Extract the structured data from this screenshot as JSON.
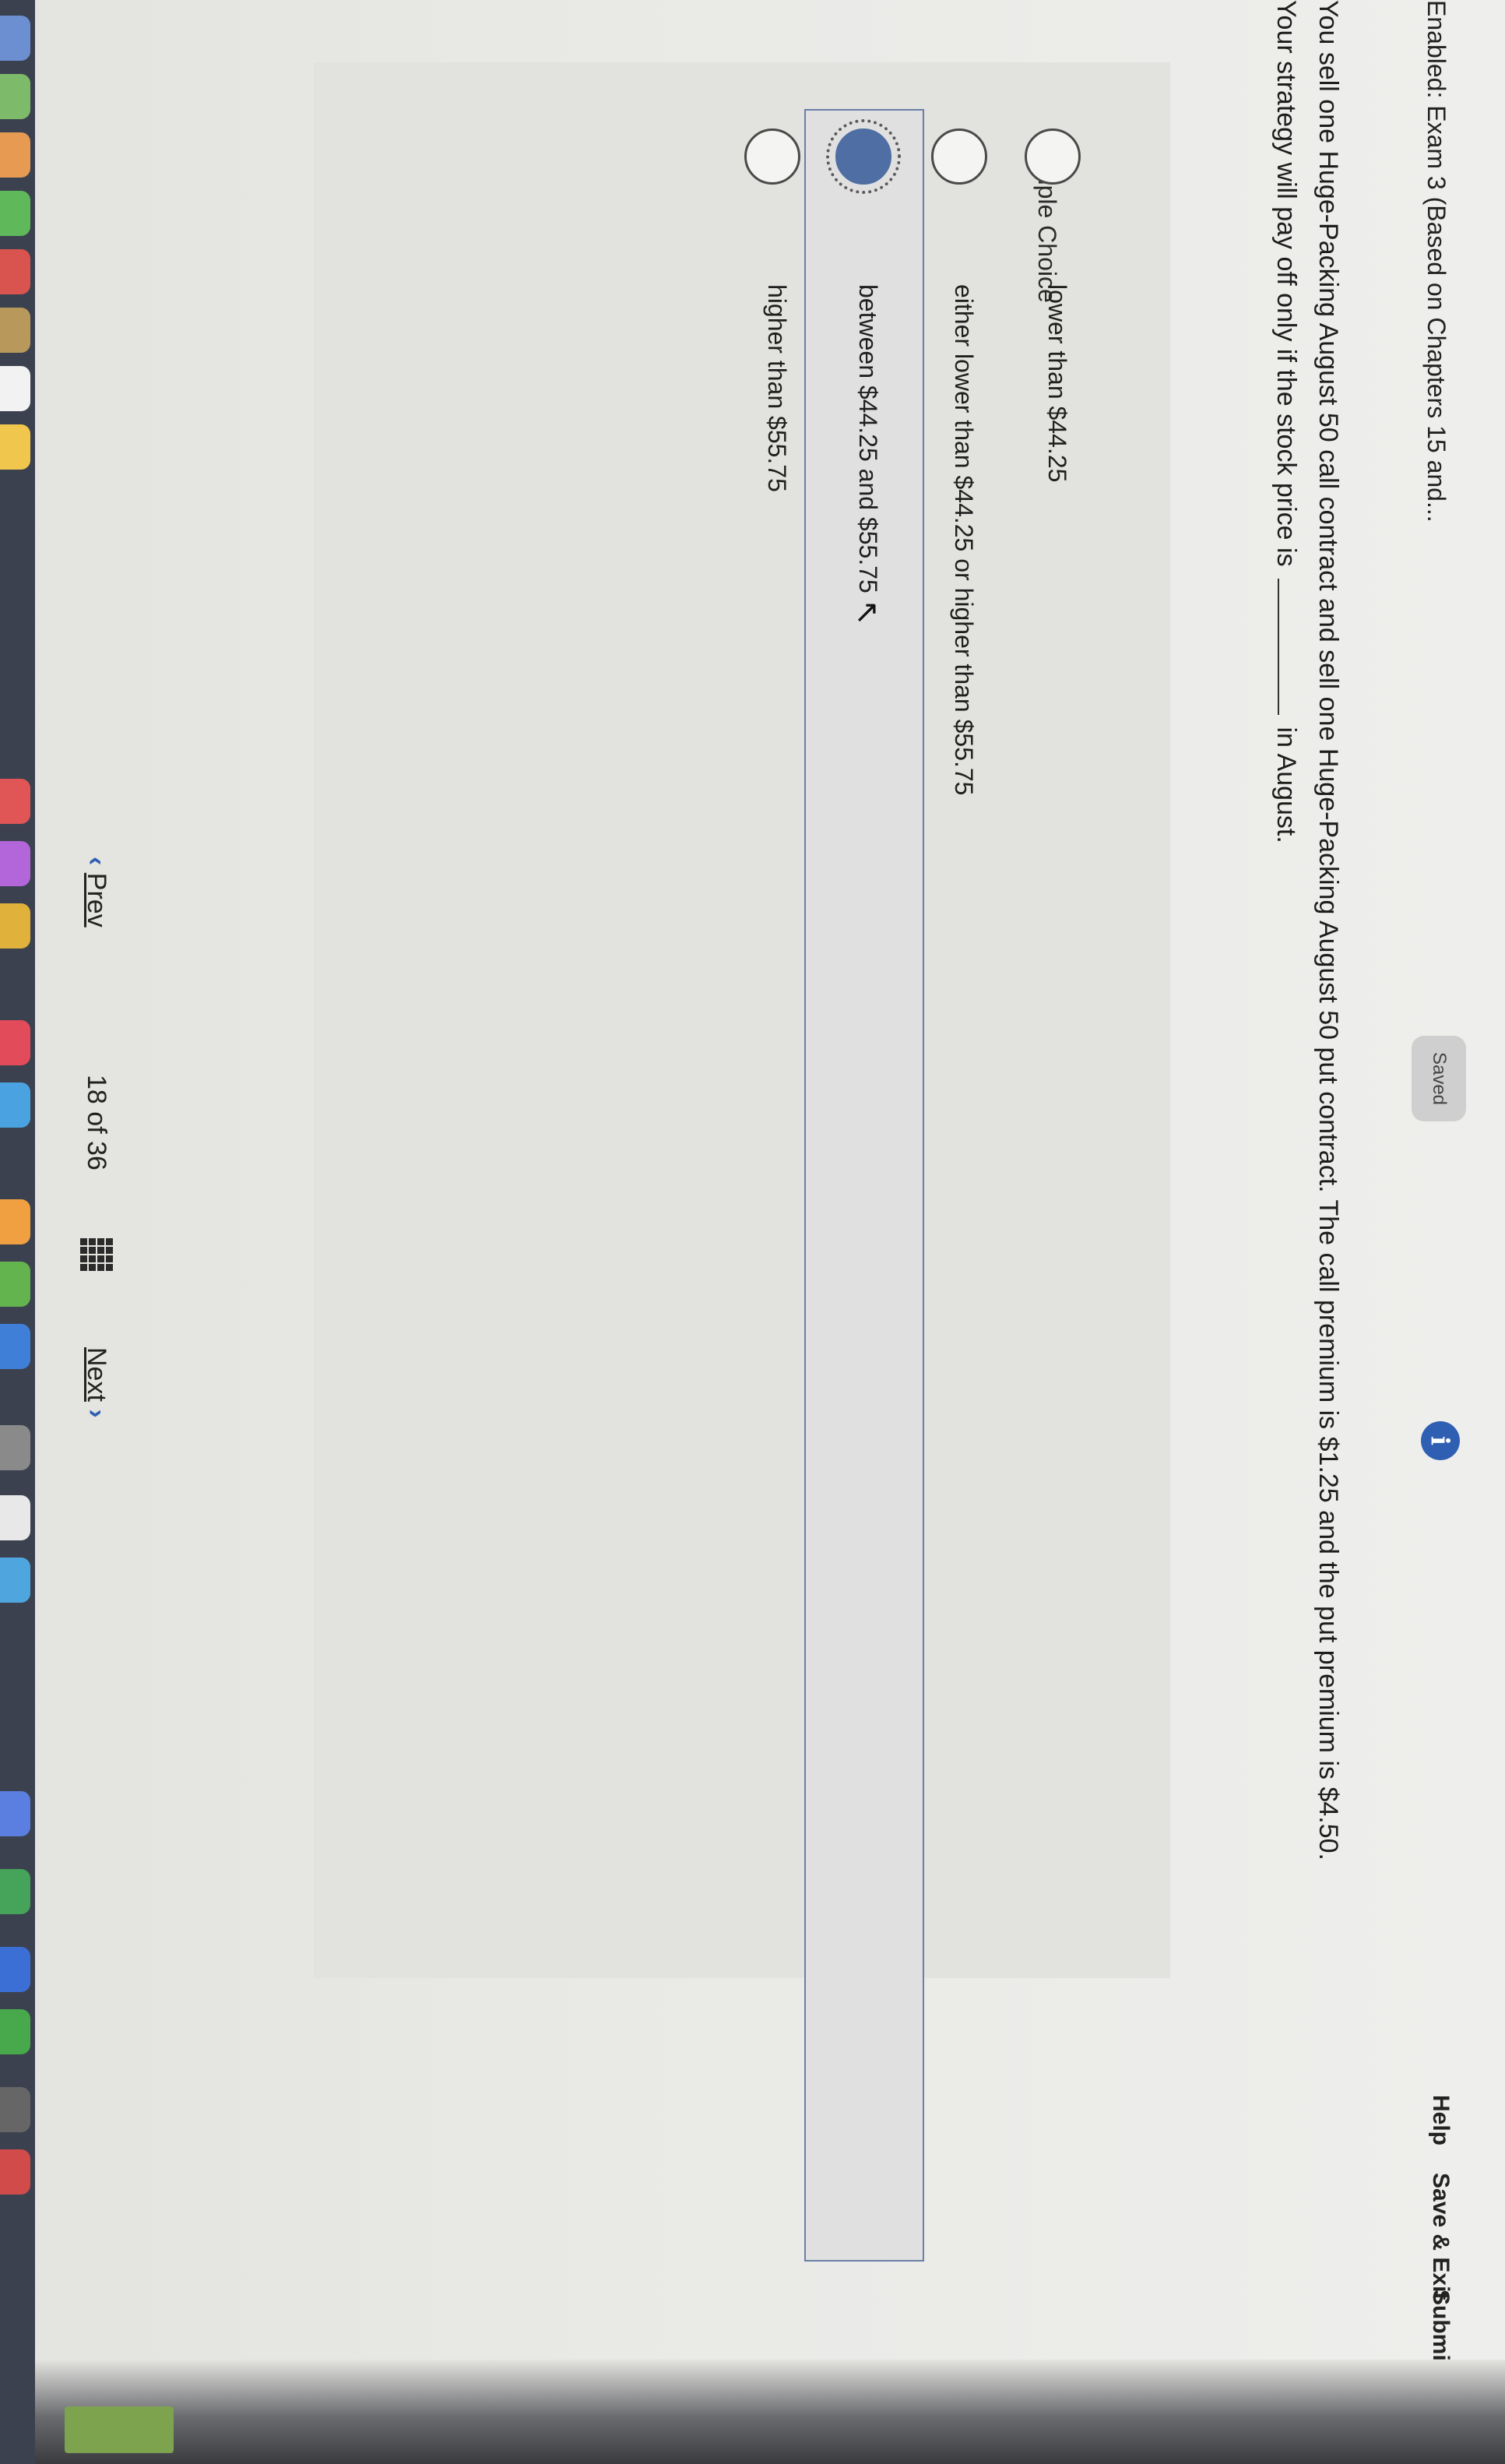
{
  "header": {
    "title": "Enabled: Exam 3 (Based on Chapters 15 and...",
    "info_icon": "i",
    "saved_label": "Saved",
    "help_label": "Help",
    "save_exit_label": "Save & Exit",
    "submit_label": "Submit"
  },
  "question": {
    "text_before_blank": "You sell one Huge-Packing August 50 call contract and sell one Huge-Packing August 50 put contract. The call premium is $1.25 and the put premium is $4.50. Your strategy will pay off only if the stock price is",
    "text_after_blank": "in August.",
    "type_label": "Multiple Choice",
    "options": [
      {
        "label": "lower than $44.25",
        "selected": false
      },
      {
        "label": "either lower than $44.25 or higher than $55.75",
        "selected": false
      },
      {
        "label": "between $44.25 and $55.75",
        "selected": true
      },
      {
        "label": "higher than $55.75",
        "selected": false
      }
    ]
  },
  "footer": {
    "prev_label": "Prev",
    "current_page": "18",
    "of_label": "of",
    "total_pages": "36",
    "next_label": "Next"
  },
  "colors": {
    "accent": "#2f5fb3",
    "selected_radio": "#4f6ea3"
  }
}
